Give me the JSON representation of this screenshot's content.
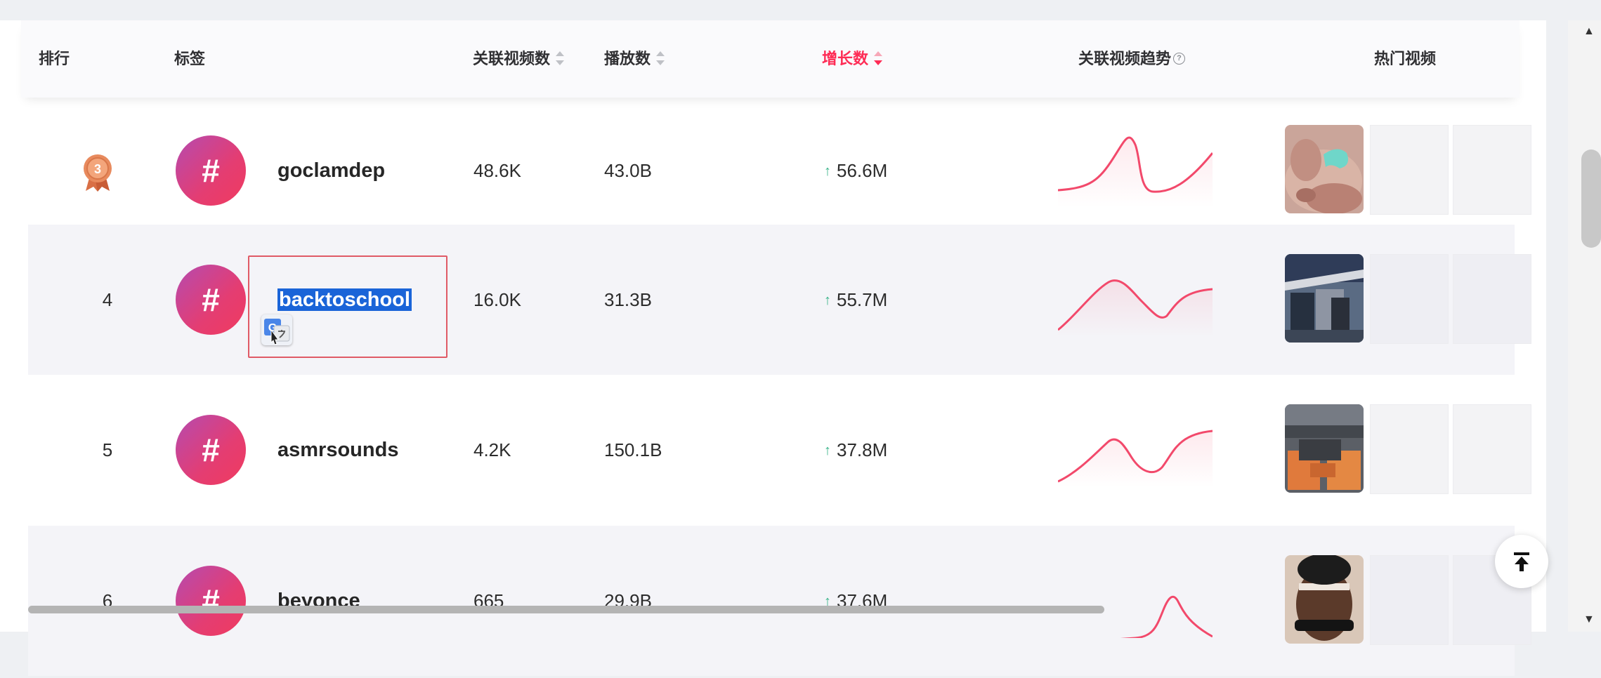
{
  "header": {
    "rank": "排行",
    "tag": "标签",
    "related_videos": "关联视频数",
    "plays": "播放数",
    "growth": "增长数",
    "trend": "关联视频趋势",
    "trend_info_icon": "?",
    "hot_videos": "热门视频"
  },
  "rows": [
    {
      "rank": "3",
      "rank_display": "medal-bronze",
      "tag": "goclamdep",
      "videos": "48.6K",
      "plays": "43.0B",
      "growth": "56.6M",
      "selected": false
    },
    {
      "rank": "4",
      "tag": "backtoschool",
      "videos": "16.0K",
      "plays": "31.3B",
      "growth": "55.7M",
      "selected": true
    },
    {
      "rank": "5",
      "tag": "asmrsounds",
      "videos": "4.2K",
      "plays": "150.1B",
      "growth": "37.8M",
      "selected": false
    },
    {
      "rank": "6",
      "tag": "beyonce",
      "videos": "665",
      "plays": "29.9B",
      "growth": "37.6M",
      "selected": false
    }
  ],
  "symbols": {
    "hash": "#",
    "up_arrow": "↑",
    "scroll_up": "▲",
    "scroll_down": "▼"
  },
  "colors": {
    "accent": "#fe2c55",
    "growth_up": "#3bb48a",
    "spark_line": "#f2496b",
    "selection": "#1a64d8"
  },
  "icons": {
    "rank_3": "bronze-medal-icon",
    "translate": "google-translate-icon",
    "back_to_top": "back-to-top-icon"
  }
}
